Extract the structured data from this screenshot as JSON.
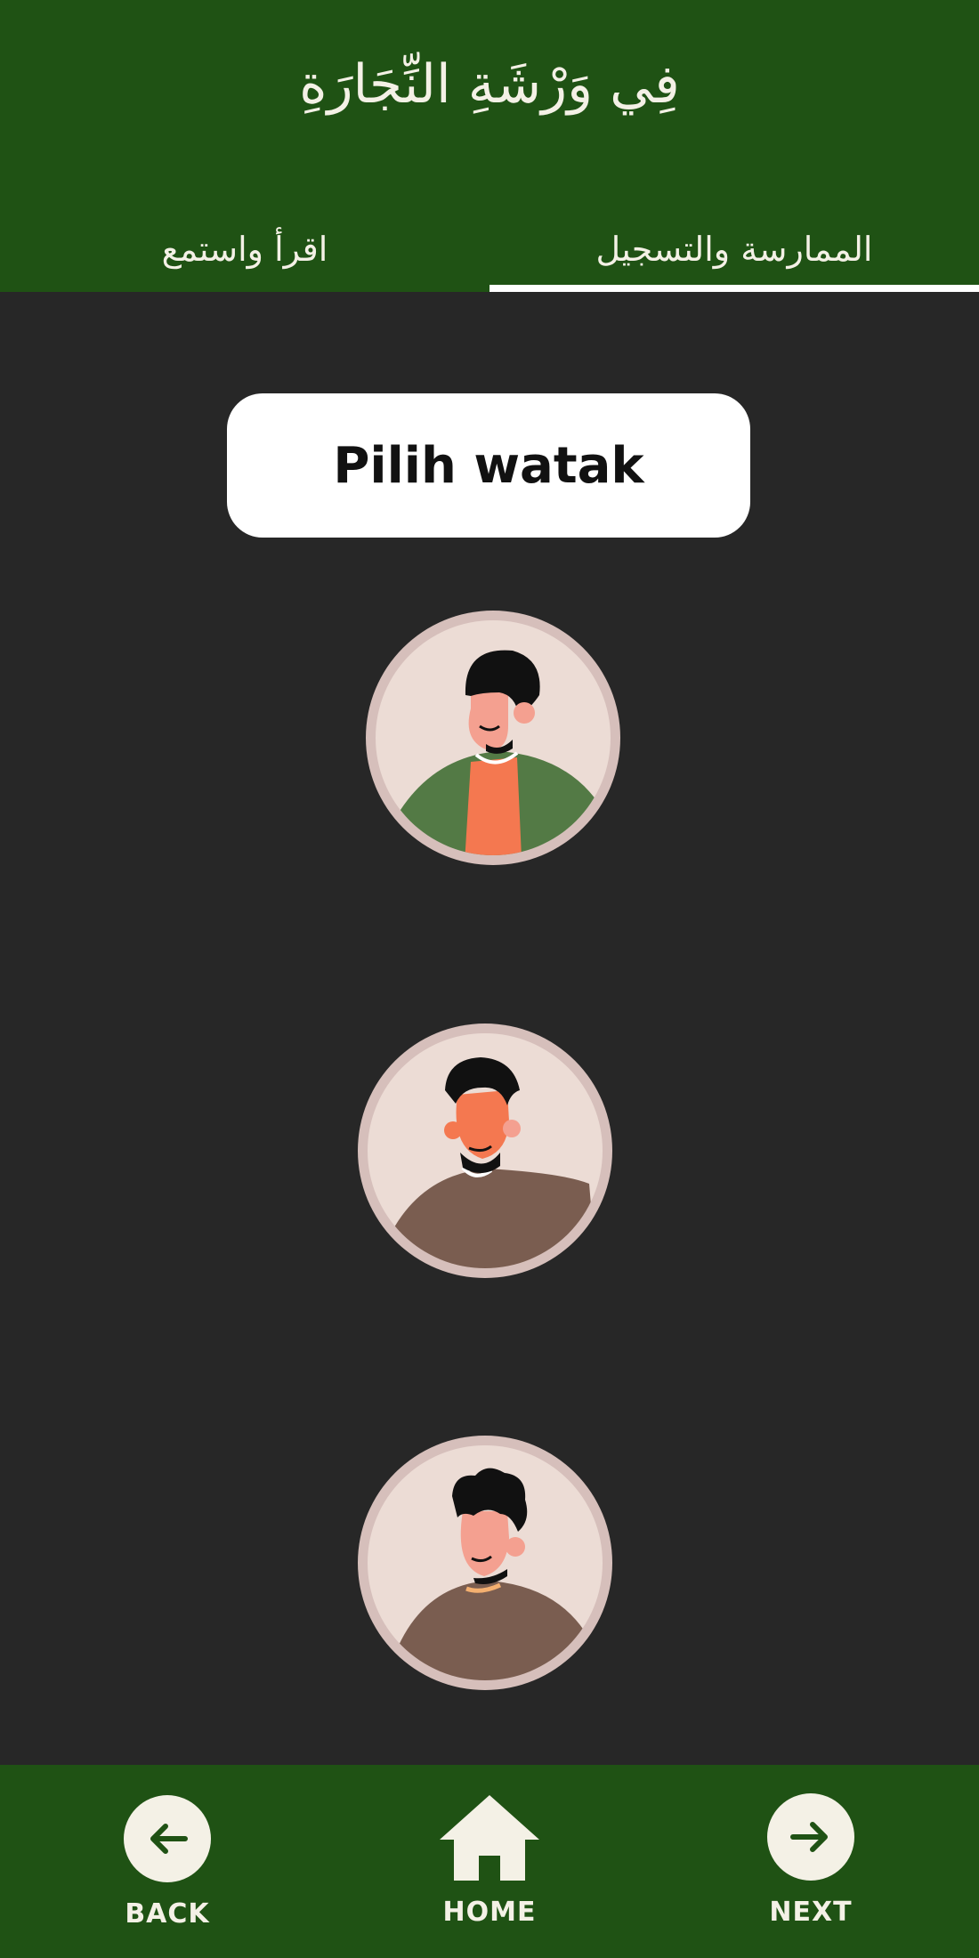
{
  "header": {
    "title": "فِي وَرْشَةِ النِّجَارَةِ",
    "tabs": [
      {
        "label": "اقرأ واستمع",
        "active": false
      },
      {
        "label": "الممارسة والتسجيل",
        "active": true
      }
    ]
  },
  "prompt": {
    "text": "Pilih watak"
  },
  "characters": [
    {
      "icon": "boy-green-jacket-avatar-icon"
    },
    {
      "icon": "boy-brown-sweater-avatar-icon"
    },
    {
      "icon": "boy-curly-hair-avatar-icon"
    }
  ],
  "footer": {
    "back_label": "BACK",
    "home_label": "HOME",
    "next_label": "NEXT"
  },
  "colors": {
    "header_bg": "#1f5214",
    "body_bg": "#272727",
    "cream": "#f4f1e6",
    "avatar_ring": "#d6bfbb",
    "avatar_bg": "#ecdcd5"
  }
}
